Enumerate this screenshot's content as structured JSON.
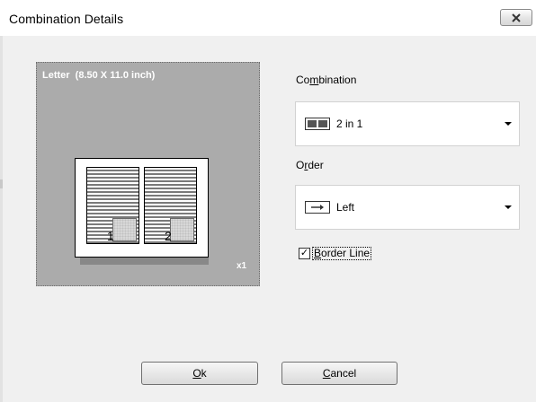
{
  "window": {
    "title": "Combination Details",
    "close_icon": "close-x-icon"
  },
  "preview": {
    "paper_size": "Letter  (8.50 X 11.0 inch)",
    "copies": "x1",
    "pages": [
      {
        "number": "1"
      },
      {
        "number": "2"
      }
    ]
  },
  "combination": {
    "label_pre": "Co",
    "label_key": "m",
    "label_post": "bination",
    "value": "2 in 1",
    "icon": "two-in-one-layout-icon"
  },
  "order": {
    "label_pre": "O",
    "label_key": "r",
    "label_post": "der",
    "value": "Left",
    "icon": "right-arrow-icon"
  },
  "border_line": {
    "checked": true,
    "check_mark": "✓",
    "label_key": "B",
    "label_post": "order Line"
  },
  "buttons": {
    "ok_key": "O",
    "ok_post": "k",
    "cancel_key": "C",
    "cancel_post": "ancel"
  }
}
